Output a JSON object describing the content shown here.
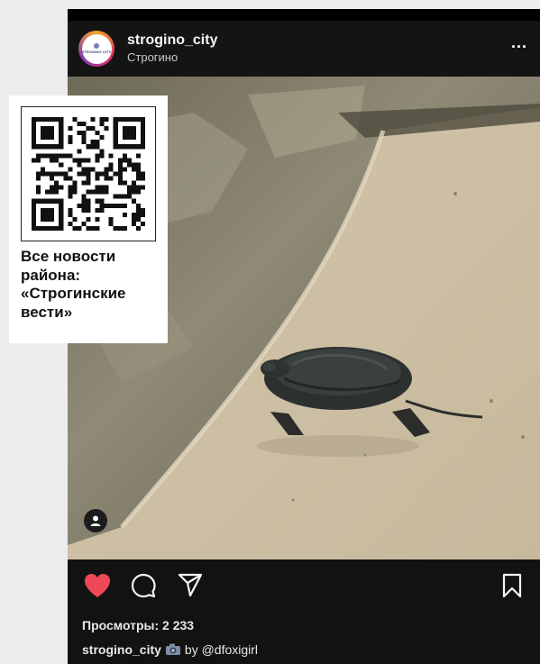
{
  "post": {
    "username": "strogino_city",
    "location": "Строгино",
    "more_label": "...",
    "avatar_text": "STROGINO CITY"
  },
  "stats": {
    "views": "Просмотры: 2 233"
  },
  "caption": {
    "username": "strogino_city",
    "text": "by @dfoxigirl"
  },
  "promo": {
    "line1": "Все новости",
    "line2": "района:",
    "line3": "«Строгинские",
    "line4": "вести»"
  },
  "colors": {
    "like": "#ed4956",
    "background": "#000000",
    "text": "#f5f5f5"
  },
  "icons": {
    "like": "heart-icon",
    "comment": "comment-icon",
    "share": "share-icon",
    "save": "bookmark-icon",
    "tag": "user-tag-icon",
    "caption": "camera-icon"
  }
}
